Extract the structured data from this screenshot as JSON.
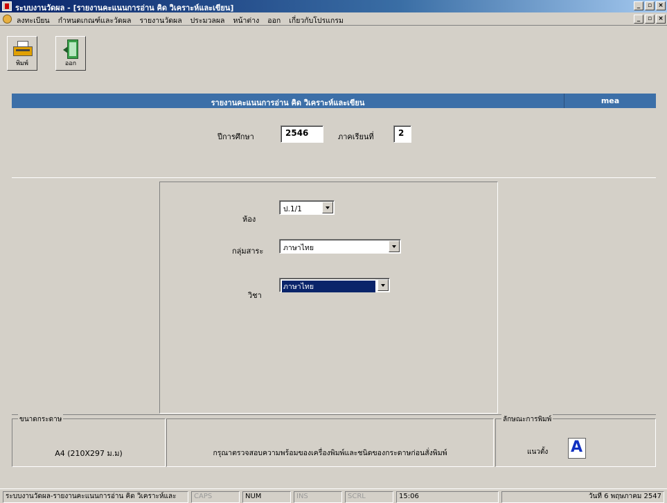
{
  "window": {
    "title": "ระบบงานวัดผล - [รายงานคะแนนการอ่าน คิด วิเคราะห์และเขียน]"
  },
  "menu": {
    "items": [
      "ลงทะเบียน",
      "กำหนดเกณฑ์และวัดผล",
      "รายงานวัดผล",
      "ประมวลผล",
      "หน้าต่าง",
      "ออก",
      "เกี่ยวกับโปรแกรม"
    ]
  },
  "toolbar": {
    "print_label": "พิมพ์",
    "exit_label": "ออก"
  },
  "report": {
    "title": "รายงานคะแนนการอ่าน คิด วิเคราะห์และเขียน",
    "code": "mea"
  },
  "period": {
    "year_label": "ปีการศึกษา",
    "year_value": "2546",
    "term_label": "ภาคเรียนที่",
    "term_value": "2"
  },
  "form": {
    "room_label": "ห้อง",
    "room_value": "ป.1/1",
    "group_label": "กลุ่มสาระ",
    "group_value": "ภาษาไทย",
    "subject_label": "วิชา",
    "subject_value": "ภาษาไทย"
  },
  "paper": {
    "title": "ขนาดกระดาษ",
    "value": "A4 (210X297 ม.ม)"
  },
  "notice": "กรุณาตรวจสอบความพร้อมของเครื่องพิมพ์และชนิดของกระดาษก่อนสั่งพิมพ์",
  "print_style": {
    "title": "ลักษณะการพิมพ์",
    "orientation": "แนวตั้ง",
    "icon_letter": "A"
  },
  "status": {
    "message": "ระบบงานวัดผล-รายงานคะแนนการอ่าน คิด วิเคราะห์และ",
    "caps": "CAPS",
    "num": "NUM",
    "ins": "INS",
    "scrl": "SCRL",
    "time": "15:06",
    "date": "วันที่ 6 พฤษภาคม 2547"
  }
}
